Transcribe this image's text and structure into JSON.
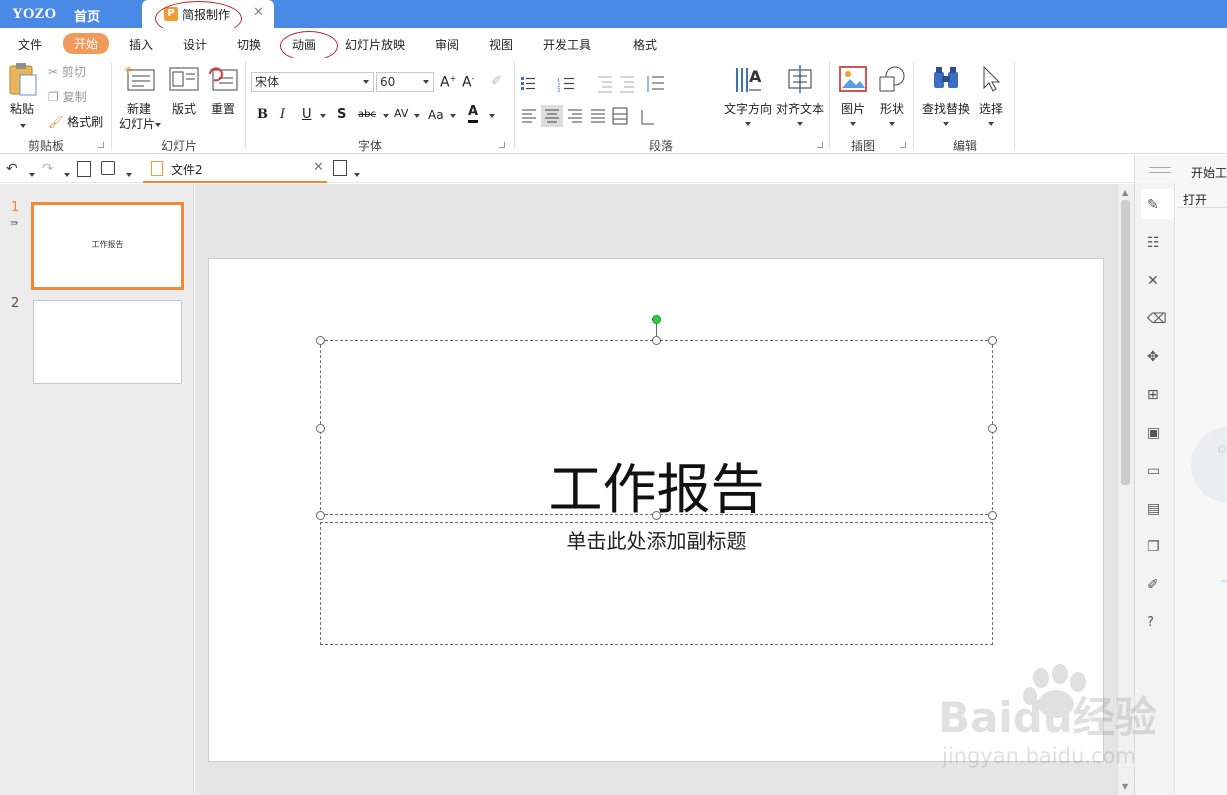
{
  "titlebar": {
    "logo": "YOZO",
    "home": "首页",
    "doc_tab_icon": "P",
    "doc_tab": "简报制作",
    "close": "✕"
  },
  "menu": [
    "文件",
    "开始",
    "插入",
    "设计",
    "切换",
    "动画",
    "幻灯片放映",
    "审阅",
    "视图",
    "开发工具",
    "格式"
  ],
  "ribbon": {
    "clipboard": {
      "label": "剪贴板",
      "paste": "粘贴",
      "cut": "剪切",
      "copy": "复制",
      "format_painter": "格式刷"
    },
    "slides": {
      "label": "幻灯片",
      "new_slide_1": "新建",
      "new_slide_2": "幻灯片",
      "layout": "版式",
      "reset": "重置"
    },
    "font": {
      "label": "字体",
      "font_name": "宋体",
      "font_size": "60",
      "bold": "B",
      "italic": "I",
      "underline": "U",
      "shadow": "S",
      "strike": "abc",
      "spacing": "AV",
      "case": "Aa",
      "color": "A"
    },
    "paragraph": {
      "label": "段落"
    },
    "text_direction": "文字方向",
    "align_text": "对齐文本",
    "insert": {
      "label": "插图",
      "picture": "图片",
      "shape": "形状"
    },
    "edit": {
      "label": "编辑",
      "find_replace": "查找替换",
      "select": "选择"
    }
  },
  "quickbar": {
    "file_tab": "文件2"
  },
  "thumbnails": [
    {
      "num": "1",
      "title": "工作报告",
      "selected": true
    },
    {
      "num": "2",
      "title": "",
      "selected": false
    }
  ],
  "slide": {
    "title": "工作报告",
    "subtitle": "单击此处添加副标题"
  },
  "right_panel": {
    "header": "开始工",
    "open": "打开"
  },
  "watermark": {
    "brand": "Baidu经验",
    "url": "jingyan.baidu.com"
  },
  "colors": {
    "titlebar": "#4a8ae6",
    "accent": "#f29a5c",
    "selection": "#f0883a"
  }
}
